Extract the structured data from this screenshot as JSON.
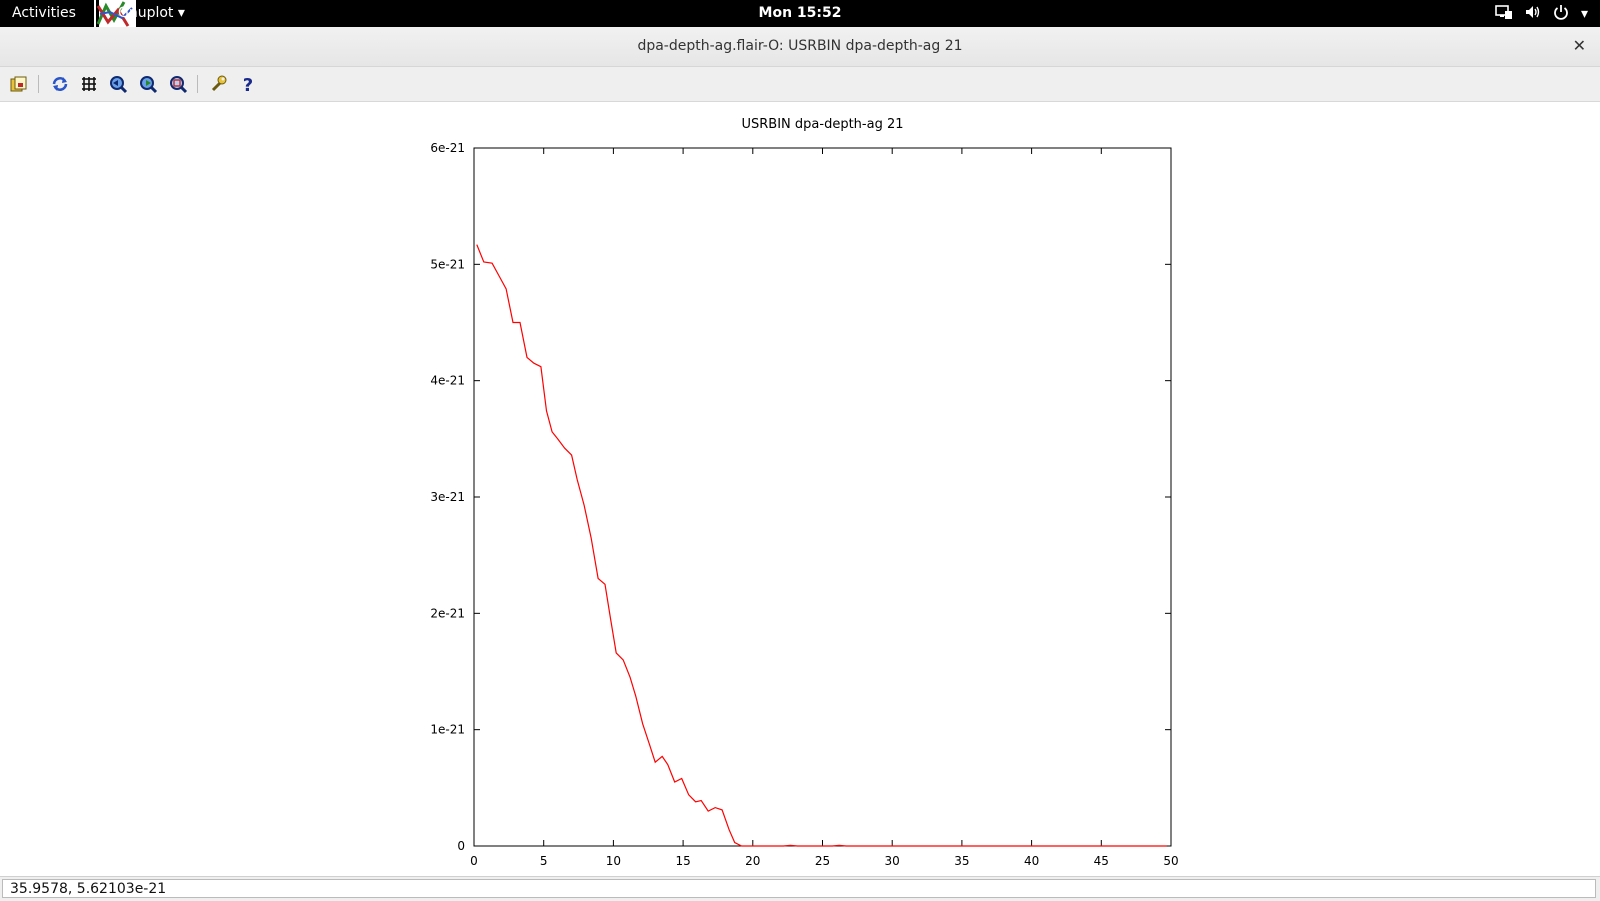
{
  "topbar": {
    "activities": "Activities",
    "app_name": "Gnuplot ▾",
    "clock": "Mon 15:52",
    "tray_icons": [
      "network-icon",
      "volume-icon",
      "power-icon"
    ],
    "tray_menu_arrow": "▾"
  },
  "window": {
    "title": "dpa-depth-ag.flair-O: USRBIN dpa-depth-ag 21",
    "close_glyph": "✕"
  },
  "toolbar": {
    "buttons": [
      "copy-to-clipboard",
      "replot",
      "grid",
      "zoom-previous",
      "zoom-next",
      "autoscale",
      "options",
      "help"
    ]
  },
  "status": {
    "coordinates": "35.9578,  5.62103e-21"
  },
  "chart_data": {
    "type": "line",
    "title": "USRBIN dpa-depth-ag 21",
    "xlabel": "",
    "ylabel": "",
    "xlim": [
      0,
      50
    ],
    "ylim": [
      0,
      6e-21
    ],
    "xticks": [
      0,
      5,
      10,
      15,
      20,
      25,
      30,
      35,
      40,
      45,
      50
    ],
    "xtick_labels": [
      "0",
      "5",
      "10",
      "15",
      "20",
      "25",
      "30",
      "35",
      "40",
      "45",
      "50"
    ],
    "yticks": [
      0,
      1e-21,
      2e-21,
      3e-21,
      4e-21,
      5e-21,
      6e-21
    ],
    "ytick_labels": [
      "0",
      "1e-21",
      "2e-21",
      "3e-21",
      "4e-21",
      "5e-21",
      "6e-21"
    ],
    "grid": false,
    "series": [
      {
        "color": "#ff0000",
        "x": [
          0.2,
          0.7,
          1.3,
          1.8,
          2.3,
          2.8,
          3.3,
          3.8,
          4.3,
          4.8,
          5.2,
          5.6,
          6.0,
          6.5,
          7.0,
          7.4,
          7.9,
          8.4,
          8.9,
          9.4,
          9.8,
          10.2,
          10.7,
          11.2,
          11.6,
          12.1,
          12.6,
          13.0,
          13.5,
          13.9,
          14.4,
          14.9,
          15.4,
          15.9,
          16.3,
          16.8,
          17.3,
          17.8,
          18.3,
          18.7,
          19.2,
          19.7,
          20.2,
          20.7,
          21.2,
          21.7,
          22.2,
          22.7,
          23.2,
          23.7,
          24.2,
          24.7,
          25.2,
          25.7,
          26.2,
          26.7,
          27.2,
          27.7,
          28.2,
          28.7,
          29.2,
          29.7,
          30.2,
          30.7,
          31.2,
          31.7,
          32.2,
          32.7,
          33.2,
          33.7,
          34.2,
          34.7,
          35.2,
          35.7,
          36.2,
          36.7,
          37.2,
          37.7,
          38.2,
          38.7,
          39.2,
          39.7,
          40.2,
          40.7,
          41.2,
          41.7,
          42.2,
          42.7,
          43.2,
          43.7,
          44.2,
          44.7,
          45.2,
          45.7,
          46.2,
          46.7,
          47.2,
          47.7,
          48.2,
          48.7,
          49.2,
          49.7
        ],
        "y": [
          5.17e-21,
          5.02e-21,
          5.01e-21,
          4.9e-21,
          4.79e-21,
          4.5e-21,
          4.5e-21,
          4.2e-21,
          4.15e-21,
          4.12e-21,
          3.74e-21,
          3.56e-21,
          3.5e-21,
          3.42e-21,
          3.36e-21,
          3.15e-21,
          2.93e-21,
          2.65e-21,
          2.3e-21,
          2.25e-21,
          1.95e-21,
          1.66e-21,
          1.6e-21,
          1.45e-21,
          1.29e-21,
          1.05e-21,
          8.7e-22,
          7.2e-22,
          7.7e-22,
          7e-22,
          5.5e-22,
          5.8e-22,
          4.4e-22,
          3.8e-22,
          3.9e-22,
          3e-22,
          3.3e-22,
          3.1e-22,
          1.4e-22,
          3e-23,
          0.0,
          0.0,
          0.0,
          0.0,
          0.0,
          0.0,
          0.0,
          5e-24,
          0.0,
          0.0,
          0.0,
          0.0,
          0.0,
          0.0,
          5e-24,
          0.0,
          0.0,
          0.0,
          0.0,
          0.0,
          0.0,
          0.0,
          0.0,
          0.0,
          0.0,
          0.0,
          0.0,
          0.0,
          0.0,
          0.0,
          0.0,
          0.0,
          0.0,
          0.0,
          0.0,
          0.0,
          0.0,
          0.0,
          0.0,
          0.0,
          0.0,
          0.0,
          0.0,
          0.0,
          0.0,
          0.0,
          0.0,
          0.0,
          0.0,
          0.0,
          0.0,
          0.0,
          0.0,
          0.0,
          0.0,
          0.0,
          0.0,
          0.0,
          0.0,
          0.0,
          0.0,
          0.0
        ]
      }
    ]
  }
}
